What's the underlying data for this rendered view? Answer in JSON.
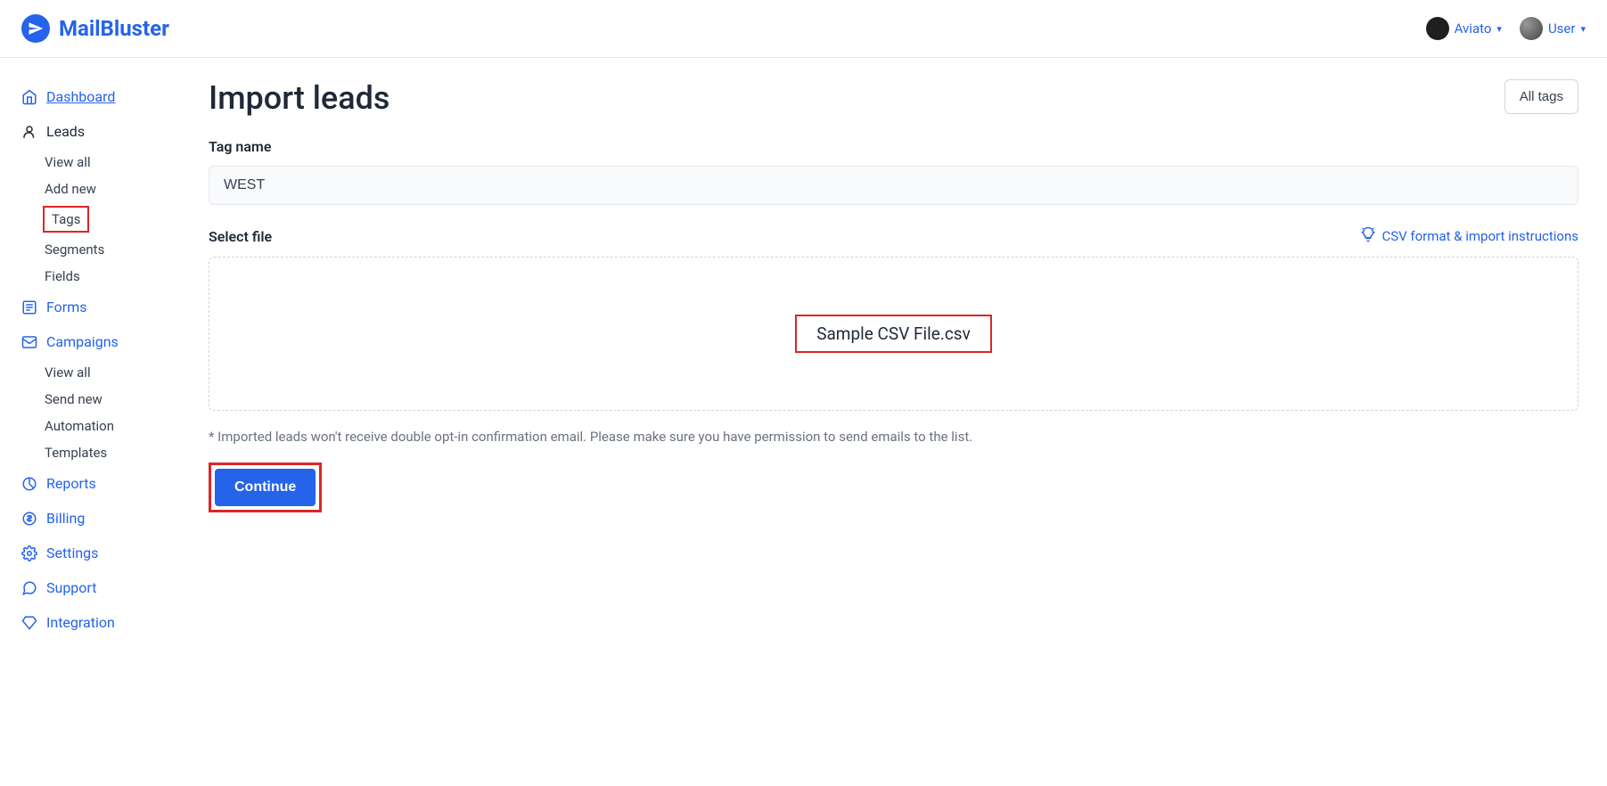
{
  "brand": "MailBluster",
  "header": {
    "org": "Aviato",
    "user": "User"
  },
  "sidebar": {
    "dashboard": "Dashboard",
    "leads": {
      "label": "Leads",
      "view_all": "View all",
      "add_new": "Add new",
      "tags": "Tags",
      "segments": "Segments",
      "fields": "Fields"
    },
    "forms": "Forms",
    "campaigns": {
      "label": "Campaigns",
      "view_all": "View all",
      "send_new": "Send new",
      "automation": "Automation",
      "templates": "Templates"
    },
    "reports": "Reports",
    "billing": "Billing",
    "settings": "Settings",
    "support": "Support",
    "integration": "Integration"
  },
  "main": {
    "title": "Import leads",
    "all_tags_btn": "All tags",
    "tag_name_label": "Tag name",
    "tag_name_value": "WEST",
    "select_file_label": "Select file",
    "csv_link": "CSV format & import instructions",
    "uploaded_file": "Sample CSV File.csv",
    "disclaimer": "* Imported leads won't receive double opt-in confirmation email. Please make sure you have permission to send emails to the list.",
    "continue_btn": "Continue"
  }
}
